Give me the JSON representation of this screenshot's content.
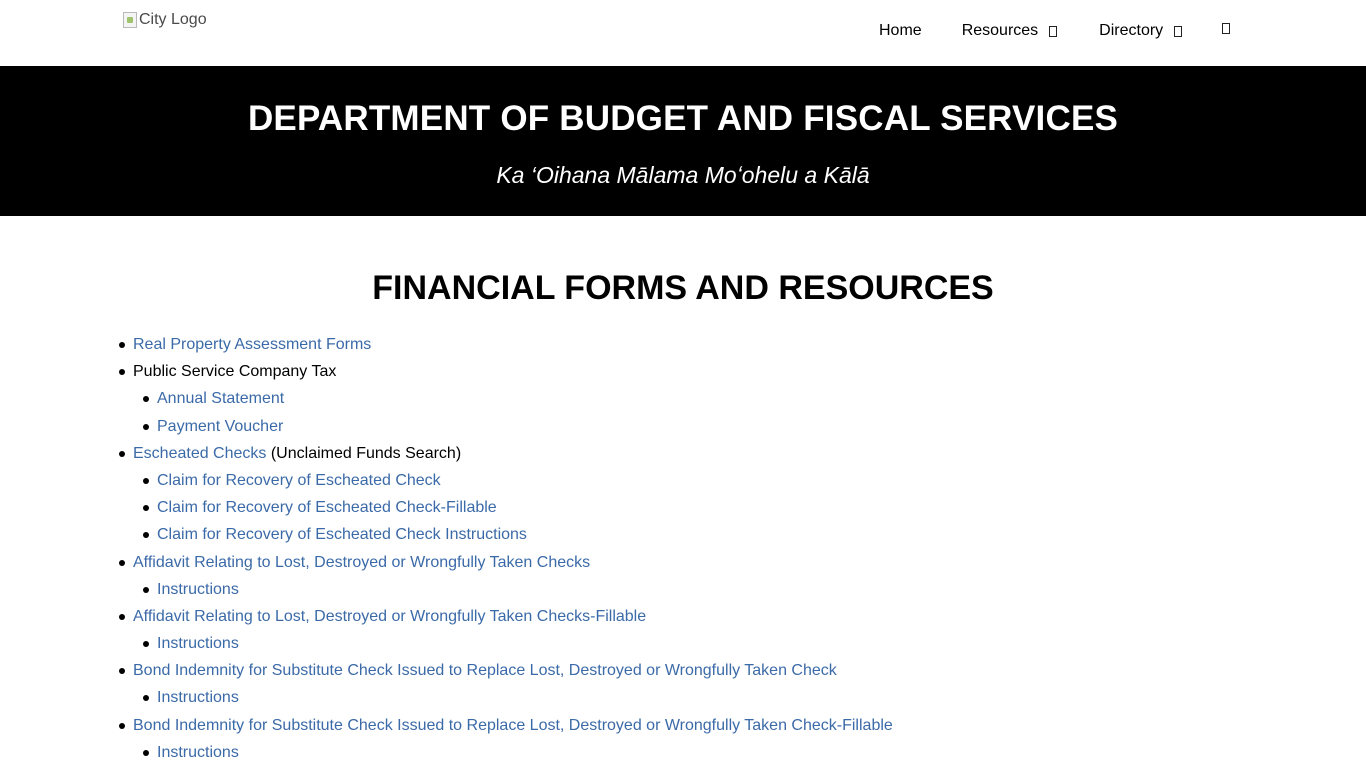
{
  "header": {
    "logo_alt": "City Logo",
    "nav": {
      "home": "Home",
      "resources": "Resources",
      "directory": "Directory"
    }
  },
  "hero": {
    "title": "DEPARTMENT OF BUDGET AND FISCAL SERVICES",
    "subtitle": "Ka ‘Oihana Mālama Moʻohelu a Kālā"
  },
  "main": {
    "heading": "FINANCIAL FORMS AND RESOURCES",
    "items": [
      {
        "text": "Real Property Assessment Forms"
      },
      {
        "text": "Public Service Company Tax"
      },
      {
        "text": "Annual Statement"
      },
      {
        "text": "Payment Voucher"
      },
      {
        "text": "Escheated Checks",
        "suffix": " (Unclaimed Funds Search)"
      },
      {
        "text": "Claim for Recovery of Escheated Check"
      },
      {
        "text": "Claim for Recovery of Escheated Check-Fillable"
      },
      {
        "text": "Claim for Recovery of Escheated Check Instructions"
      },
      {
        "text": "Affidavit Relating to Lost, Destroyed or Wrongfully Taken Checks"
      },
      {
        "text": "Instructions"
      },
      {
        "text": "Affidavit Relating to Lost, Destroyed or Wrongfully Taken Checks-Fillable"
      },
      {
        "text": "Instructions"
      },
      {
        "text": "Bond Indemnity for Substitute Check Issued to Replace Lost, Destroyed or Wrongfully Taken Check"
      },
      {
        "text": "Instructions"
      },
      {
        "text": "Bond Indemnity for Substitute Check Issued to Replace Lost, Destroyed or Wrongfully Taken Check-Fillable"
      },
      {
        "text": "Instructions"
      }
    ]
  },
  "colors": {
    "link": "#3b6aa8",
    "hero_bg": "#000000"
  },
  "icons": {
    "resources_dropdown": "glyph-box-icon",
    "directory_dropdown": "glyph-box-icon",
    "search": "search-icon"
  }
}
